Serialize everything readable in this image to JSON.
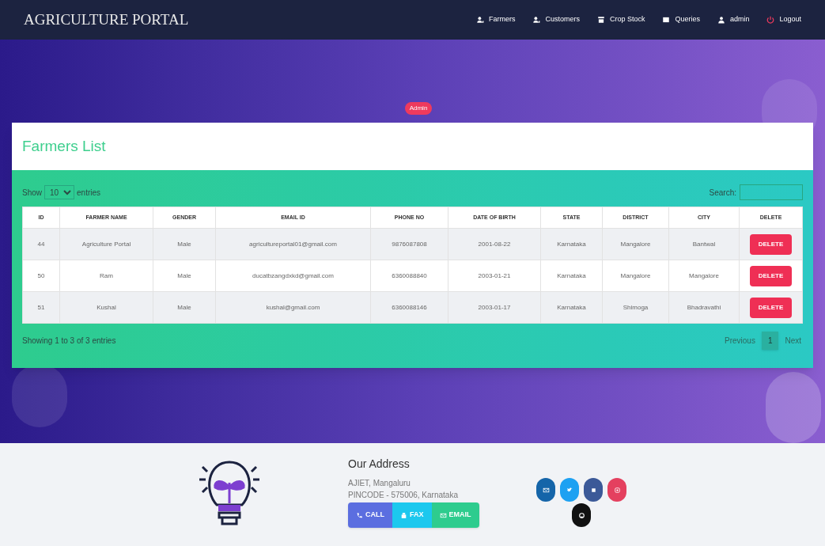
{
  "brand": "AGRICULTURE PORTAL",
  "nav": [
    {
      "label": "Farmers"
    },
    {
      "label": "Customers"
    },
    {
      "label": "Crop Stock"
    },
    {
      "label": "Queries"
    },
    {
      "label": "admin"
    },
    {
      "label": "Logout"
    }
  ],
  "badge": "Admin",
  "card": {
    "title": "Farmers List",
    "show_label": "Show",
    "entries_value": "10",
    "entries_label": "entries",
    "search_label": "Search:",
    "columns": [
      "ID",
      "FARMER NAME",
      "GENDER",
      "EMAIL ID",
      "PHONE NO",
      "DATE OF BIRTH",
      "STATE",
      "DISTRICT",
      "CITY",
      "DELETE"
    ],
    "rows": [
      {
        "cells": [
          "44",
          "Agriculture Portal",
          "Male",
          "agricultureportal01@gmail.com",
          "9876087808",
          "2001-08-22",
          "Karnataka",
          "Mangalore",
          "Bantwal"
        ],
        "action": "DELETE"
      },
      {
        "cells": [
          "50",
          "Ram",
          "Male",
          "ducatbzangdxkd@gmail.com",
          "6360088840",
          "2003-01-21",
          "Karnataka",
          "Mangalore",
          "Mangalore"
        ],
        "action": "DELETE"
      },
      {
        "cells": [
          "51",
          "Kushal",
          "Male",
          "kushal@gmail.com",
          "6360088146",
          "2003-01-17",
          "Karnataka",
          "Shimoga",
          "Bhadravathi"
        ],
        "action": "DELETE"
      }
    ],
    "info": "Showing 1 to 3 of 3 entries",
    "pagination": [
      {
        "label": "Previous",
        "selected": false
      },
      {
        "label": "1",
        "selected": true
      },
      {
        "label": "Next",
        "selected": false
      }
    ]
  },
  "footer": {
    "heading": "Our Address",
    "lines": [
      "AJIET, Mangaluru",
      "PINCODE - 575006, Karnataka"
    ],
    "buttons": [
      {
        "label": "CALL",
        "color": "#5b6ee0"
      },
      {
        "label": "FAX",
        "color": "#1cc8ee"
      },
      {
        "label": "EMAIL",
        "color": "#2ecc8e"
      }
    ],
    "social": [
      {
        "color": "#1565a9"
      },
      {
        "color": "#1da1f2"
      },
      {
        "color": "#3b5998"
      },
      {
        "color": "#e4405f"
      },
      {
        "color": "#111111"
      }
    ]
  }
}
